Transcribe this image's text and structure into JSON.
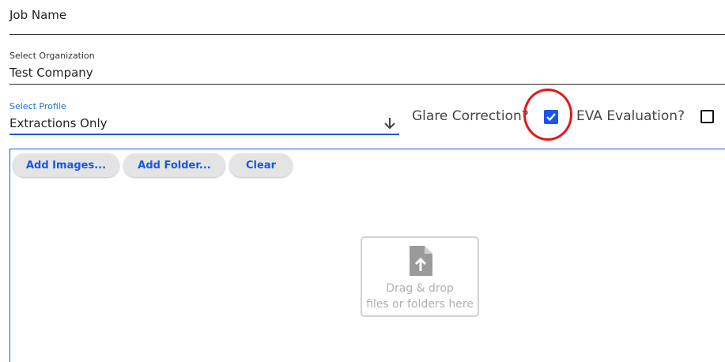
{
  "form": {
    "job_name_placeholder": "Job Name",
    "organization": {
      "label": "Select Organization",
      "value": "Test Company"
    },
    "profile": {
      "label": "Select Profile",
      "value": "Extractions Only",
      "icon": "arrow-down-icon"
    },
    "glare_correction": {
      "label": "Glare Correction?",
      "checked": true
    },
    "eva_evaluation": {
      "label": "EVA Evaluation?",
      "checked": false
    }
  },
  "toolbar": {
    "add_images": "Add Images...",
    "add_folder": "Add Folder...",
    "clear": "Clear"
  },
  "dropzone": {
    "line1": "Drag & drop",
    "line2": "files or folders here",
    "icon": "file-upload-icon"
  },
  "colors": {
    "accent": "#1a56e8",
    "annotation_circle": "#e3171a"
  }
}
